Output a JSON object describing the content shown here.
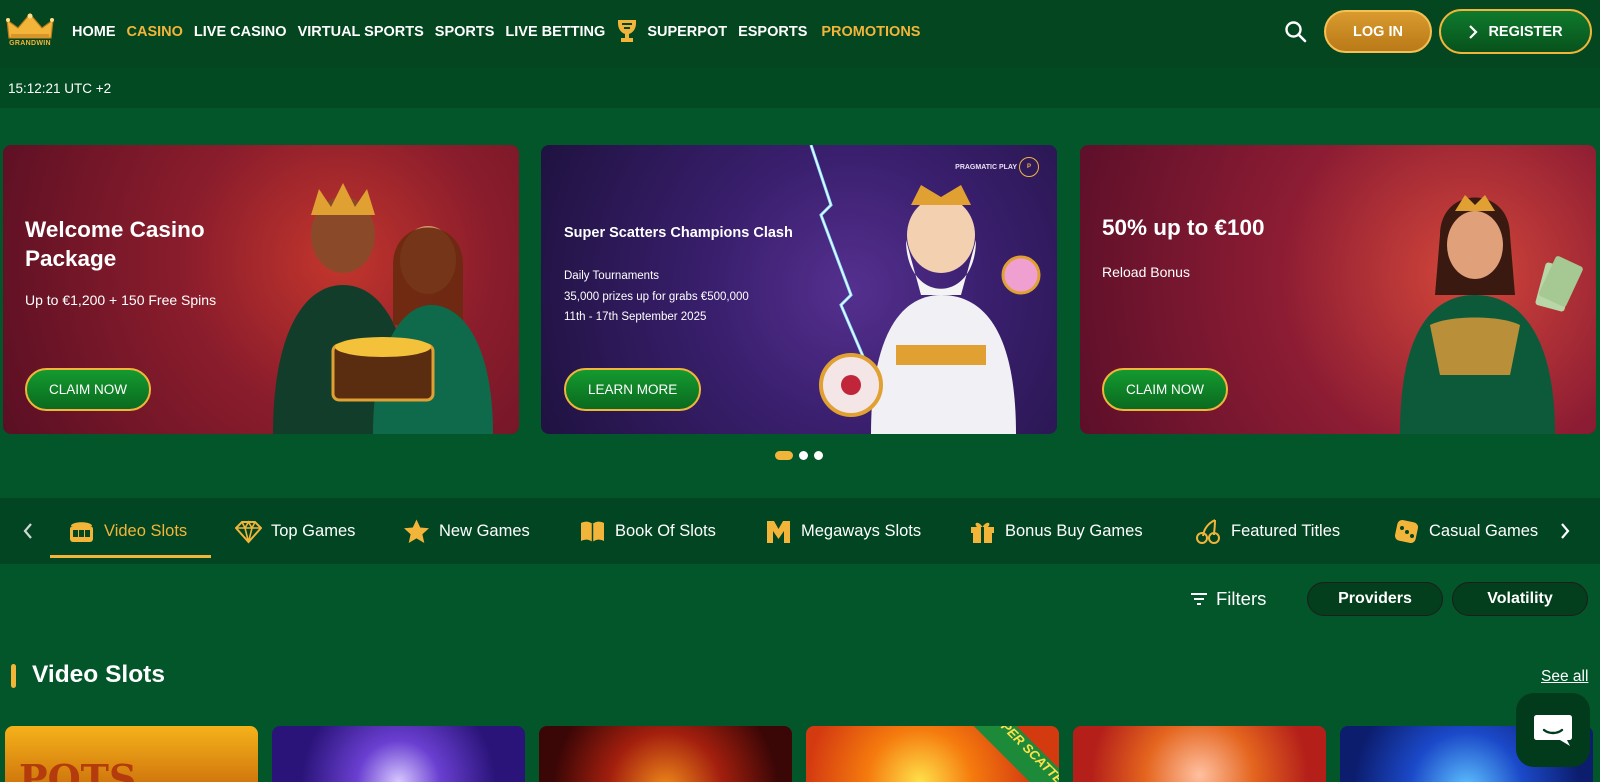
{
  "brand": {
    "logo_text": "GRANDWIN",
    "accent": "#f2b53a",
    "bg": "#03552a"
  },
  "nav": {
    "items": [
      {
        "label": "HOME"
      },
      {
        "label": "CASINO"
      },
      {
        "label": "LIVE CASINO"
      },
      {
        "label": "VIRTUAL SPORTS"
      },
      {
        "label": "SPORTS"
      },
      {
        "label": "LIVE BETTING"
      },
      {
        "label": "SUPERPOT",
        "icon": "trophy-icon"
      },
      {
        "label": "ESPORTS"
      },
      {
        "label": "PROMOTIONS"
      }
    ],
    "active": "CASINO",
    "login_label": "LOG IN",
    "register_label": "REGISTER"
  },
  "time": "15:12:21 UTC +2",
  "banners": [
    {
      "title": "Welcome Casino Package",
      "subtitle": "Up to €1,200 + 150 Free Spins",
      "cta": "CLAIM NOW"
    },
    {
      "title": "Super Scatters Champions Clash",
      "lines": [
        "Daily Tournaments",
        "35,000 prizes up for grabs €500,000",
        "11th - 17th September 2025"
      ],
      "provider": "PRAGMATIC PLAY",
      "cta": "LEARN MORE"
    },
    {
      "title": "50% up to €100",
      "subtitle": "Reload Bonus",
      "cta": "CLAIM NOW"
    }
  ],
  "carousel": {
    "slides": 3,
    "active": 1
  },
  "categories": [
    {
      "label": "Video Slots",
      "icon": "slot-machine-icon"
    },
    {
      "label": "Top Games",
      "icon": "diamond-icon"
    },
    {
      "label": "New Games",
      "icon": "star-icon"
    },
    {
      "label": "Book Of Slots",
      "icon": "book-icon"
    },
    {
      "label": "Megaways Slots",
      "icon": "megaways-icon"
    },
    {
      "label": "Bonus Buy Games",
      "icon": "gift-icon"
    },
    {
      "label": "Featured Titles",
      "icon": "cherries-icon"
    },
    {
      "label": "Casual Games",
      "icon": "dice-icon"
    }
  ],
  "active_category": "Video Slots",
  "filters": {
    "label": "Filters",
    "providers": "Providers",
    "volatility": "Volatility"
  },
  "section": {
    "title": "Video Slots",
    "see_all": "See all"
  },
  "tiles": [
    {
      "word": "POTS"
    },
    {
      "word": ""
    },
    {
      "word": ""
    },
    {
      "word": "",
      "ribbon": "SUPER SCATTER"
    },
    {
      "word": ""
    },
    {
      "word": ""
    }
  ]
}
